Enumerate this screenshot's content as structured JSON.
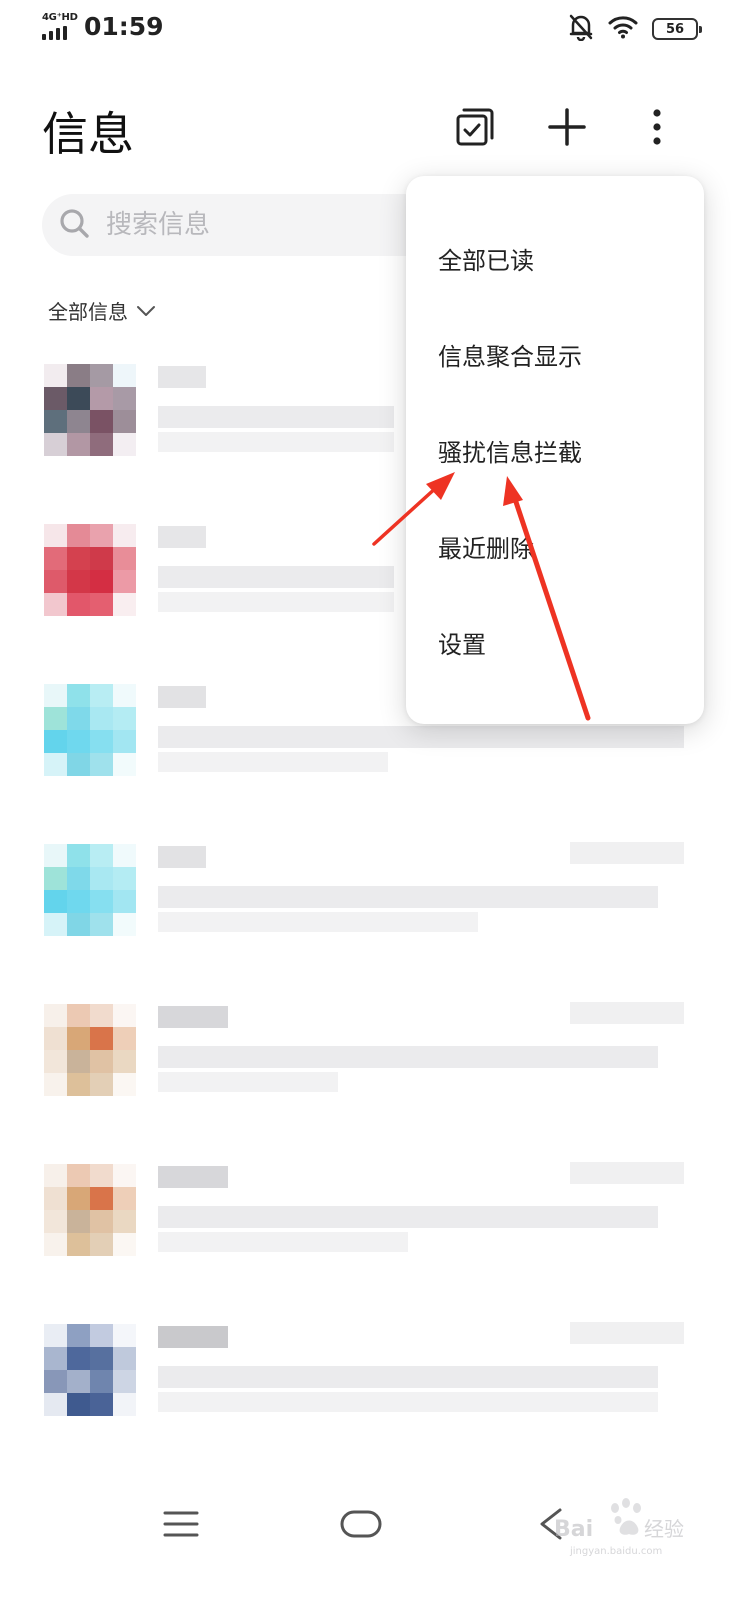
{
  "status_bar": {
    "network": "4G⁺HD",
    "time": "01:59",
    "battery": "56",
    "icons": [
      "signal-icon",
      "bell-muted-icon",
      "wifi-icon",
      "battery-icon"
    ]
  },
  "header": {
    "title": "信息",
    "actions": [
      "multi-select-icon",
      "plus-icon",
      "more-vertical-icon"
    ]
  },
  "search": {
    "placeholder": "搜索信息"
  },
  "filter": {
    "label": "全部信息"
  },
  "menu": {
    "items": [
      {
        "label": "全部已读"
      },
      {
        "label": "信息聚合显示"
      },
      {
        "label": "骚扰信息拦截"
      },
      {
        "label": "最近删除"
      },
      {
        "label": "设置"
      }
    ]
  },
  "annotation": {
    "arrow_color": "#ee3323"
  },
  "nav_bar": {
    "buttons": [
      "menu-icon",
      "home-icon",
      "back-icon"
    ]
  },
  "watermark": {
    "text": "Baidu经验",
    "subtext": "jingyan.baidu.com"
  }
}
